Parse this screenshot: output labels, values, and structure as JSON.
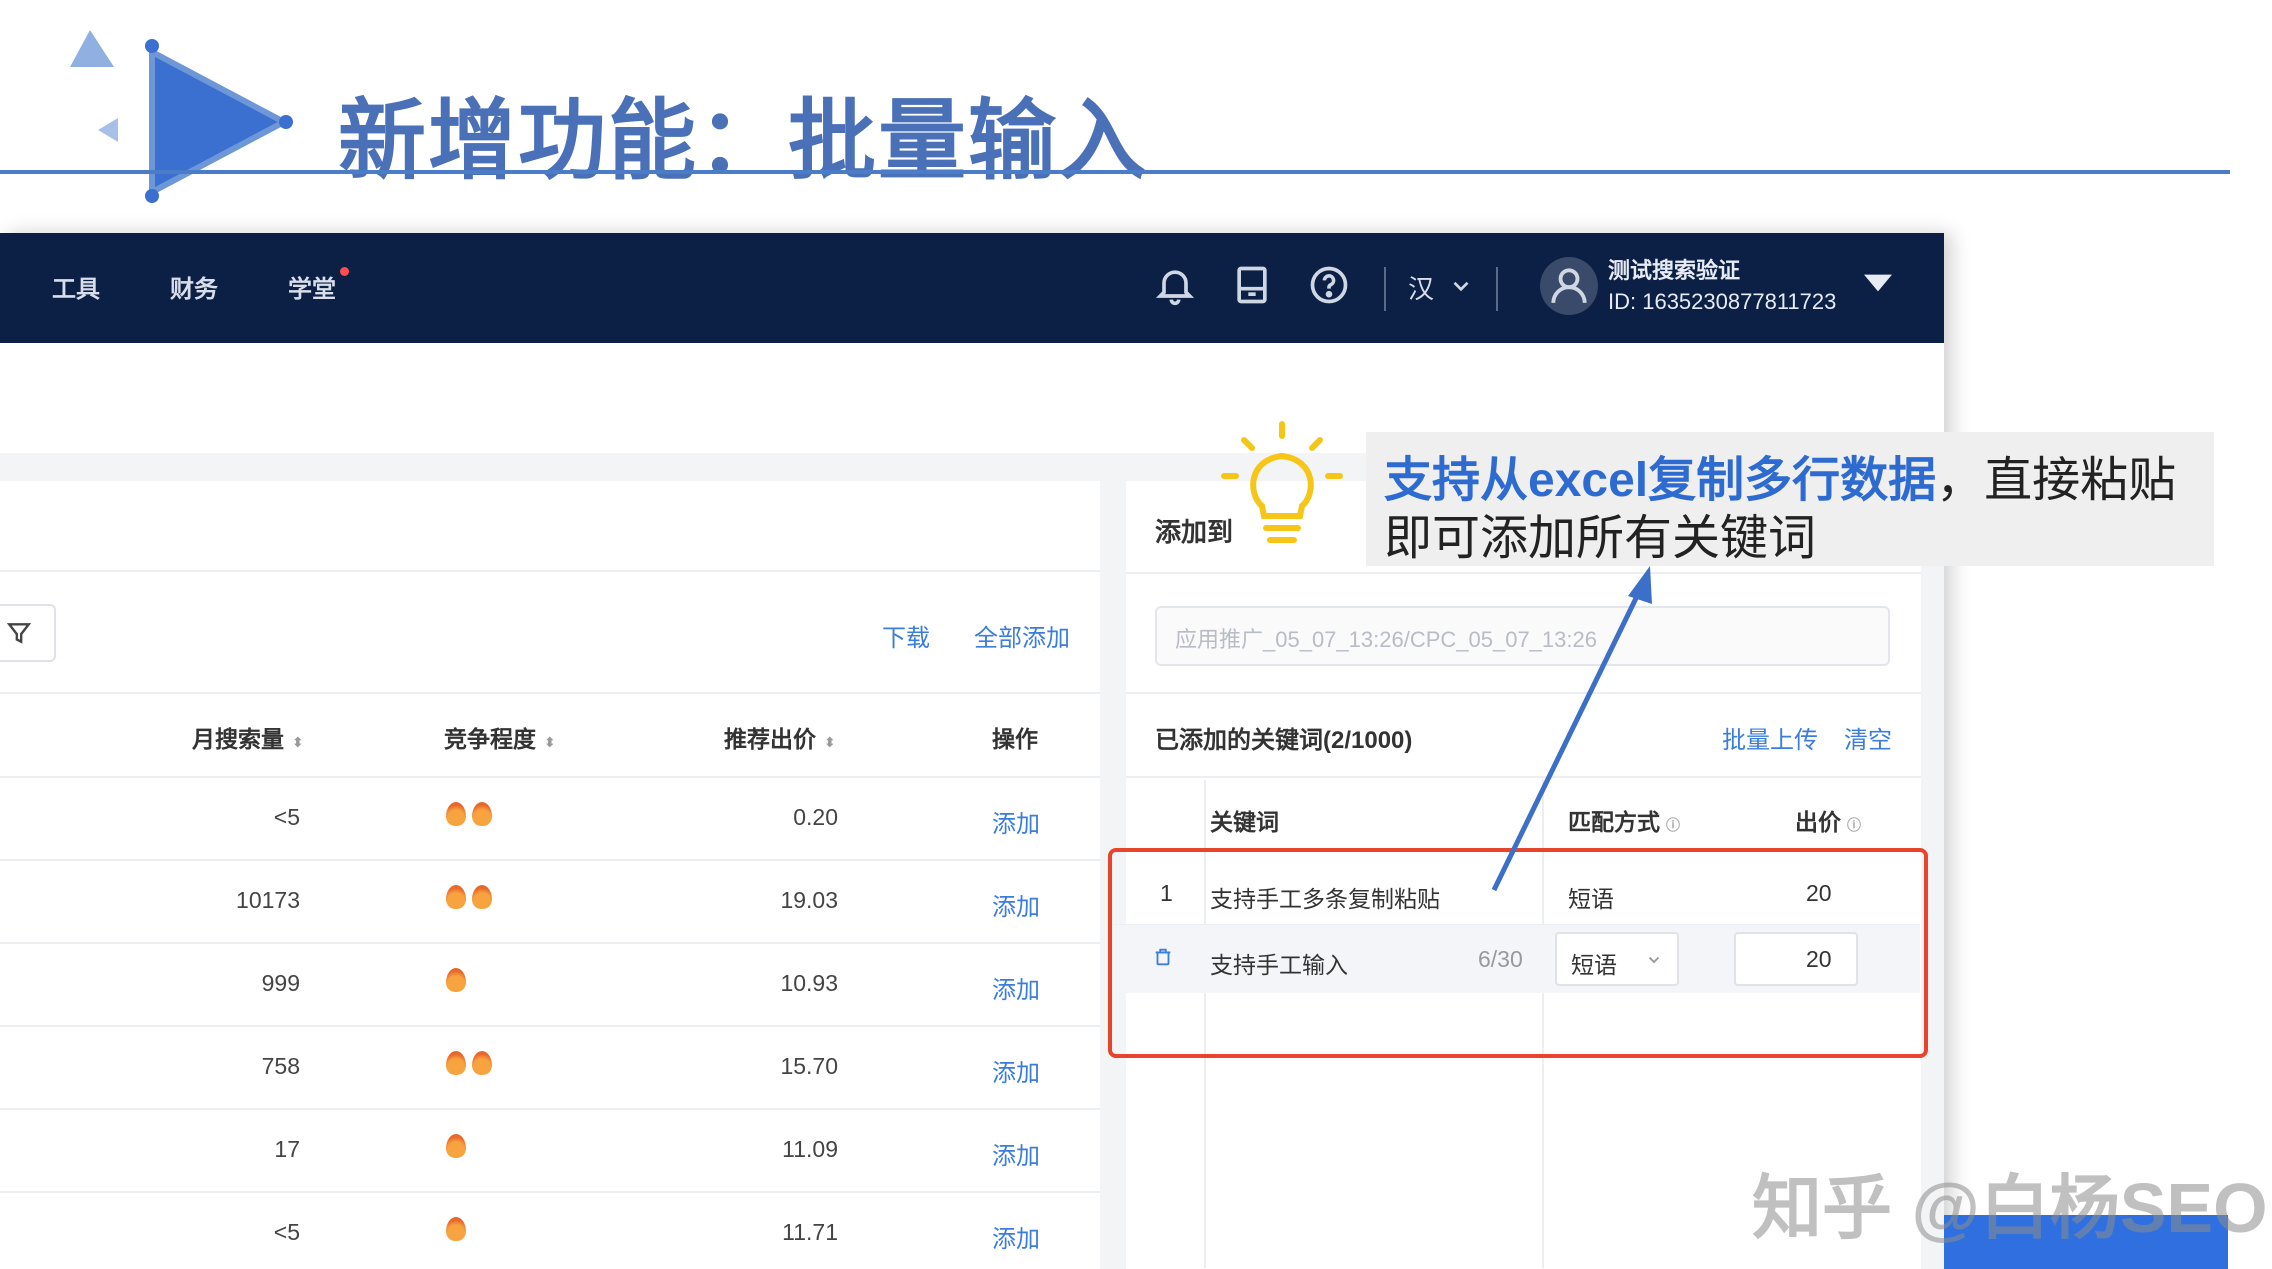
{
  "slide": {
    "title": "新增功能：批量输入"
  },
  "topbar": {
    "nav": [
      {
        "label": "工具"
      },
      {
        "label": "财务"
      },
      {
        "label": "学堂"
      }
    ],
    "lang": "汉",
    "account_name": "测试搜索验证",
    "account_id": "ID: 1635230877811723"
  },
  "left_panel": {
    "download_link": "下载",
    "add_all_link": "全部添加",
    "columns": [
      {
        "label": "月搜索量",
        "sortable": true
      },
      {
        "label": "竞争程度",
        "sortable": true
      },
      {
        "label": "推荐出价",
        "sortable": true
      },
      {
        "label": "操作",
        "sortable": false
      }
    ],
    "rows": [
      {
        "volume": "<5",
        "competition": 2,
        "bid": "0.20",
        "action": "添加"
      },
      {
        "volume": "10173",
        "competition": 2,
        "bid": "19.03",
        "action": "添加"
      },
      {
        "volume": "999",
        "competition": 1,
        "bid": "10.93",
        "action": "添加"
      },
      {
        "volume": "758",
        "competition": 2,
        "bid": "15.70",
        "action": "添加"
      },
      {
        "volume": "17",
        "competition": 1,
        "bid": "11.09",
        "action": "添加"
      },
      {
        "volume": "<5",
        "competition": 1,
        "bid": "11.71",
        "action": "添加"
      }
    ]
  },
  "right_panel": {
    "title": "添加到",
    "input_placeholder": "应用推广_05_07_13:26/CPC_05_07_13:26",
    "added_label": "已添加的关键词(2/1000)",
    "bulk_upload": "批量上传",
    "clear": "清空",
    "headers": {
      "keyword": "关键词",
      "match": "匹配方式",
      "bid": "出价"
    },
    "keywords": [
      {
        "index": "1",
        "keyword": "支持手工多条复制粘贴",
        "match": "短语",
        "bid": "20"
      },
      {
        "index": "",
        "keyword": "支持手工输入",
        "counter": "6/30",
        "match": "短语",
        "bid": "20"
      }
    ]
  },
  "callout": {
    "highlight": "支持从excel复制多行数据",
    "rest_line1": "，直接粘贴",
    "line2": "即可添加所有关键词"
  },
  "watermark": "知乎 @白杨SEO",
  "colors": {
    "title_blue": "#4a70b8",
    "navbar": "#0c1f45",
    "link_blue": "#3b7ddd",
    "highlight_blue": "#2e6bd0",
    "frame_red": "#e8442c",
    "bulb_yellow": "#f5c518"
  }
}
